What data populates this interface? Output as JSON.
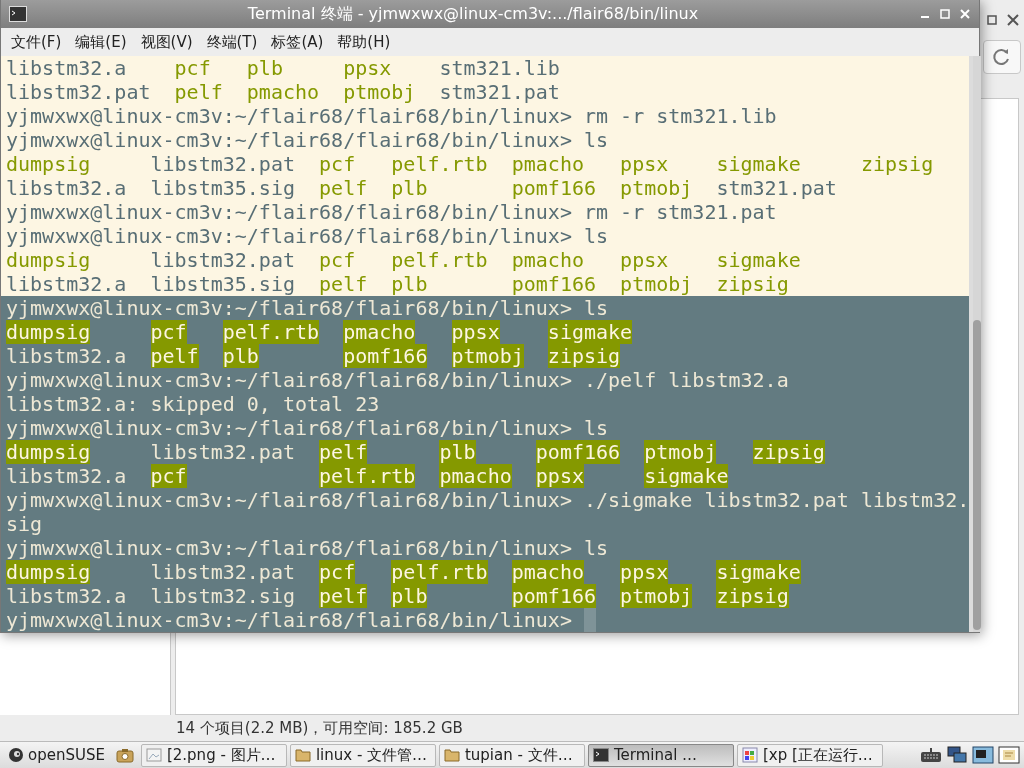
{
  "terminal_window": {
    "title": "Terminal 终端 - yjmwxwx@linux-cm3v:.../flair68/bin/linux",
    "menu": [
      "文件(F)",
      "编辑(E)",
      "视图(V)",
      "终端(T)",
      "标签(A)",
      "帮助(H)"
    ],
    "lines": [
      {
        "kind": "listing",
        "selected": true,
        "rows": [
          [
            {
              "text": "libstm32.a",
              "exec": false
            },
            {
              "text": "pcf",
              "exec": true
            },
            {
              "text": "plb",
              "exec": true
            },
            {
              "text": "ppsx",
              "exec": true
            },
            {
              "text": "stm321.lib",
              "exec": false
            }
          ],
          [
            {
              "text": "libstm32.pat",
              "exec": false
            },
            {
              "text": "pelf",
              "exec": true
            },
            {
              "text": "pmacho",
              "exec": true
            },
            {
              "text": "ptmobj",
              "exec": true
            },
            {
              "text": "stm321.pat",
              "exec": false
            }
          ]
        ]
      },
      {
        "kind": "prompt",
        "selected": true,
        "prompt": "yjmwxwx@linux-cm3v:~/flair68/flair68/bin/linux>",
        "command": "rm -r stm321.lib"
      },
      {
        "kind": "prompt",
        "selected": true,
        "prompt": "yjmwxwx@linux-cm3v:~/flair68/flair68/bin/linux>",
        "command": "ls"
      },
      {
        "kind": "listing",
        "selected": true,
        "rows": [
          [
            {
              "text": "dumpsig",
              "exec": true
            },
            {
              "text": "libstm32.pat",
              "exec": false
            },
            {
              "text": "pcf",
              "exec": true
            },
            {
              "text": "pelf.rtb",
              "exec": true
            },
            {
              "text": "pmacho",
              "exec": true
            },
            {
              "text": "ppsx",
              "exec": true
            },
            {
              "text": "sigmake",
              "exec": true
            },
            {
              "text": "zipsig",
              "exec": true
            }
          ],
          [
            {
              "text": "libstm32.a",
              "exec": false
            },
            {
              "text": "libstm35.sig",
              "exec": false
            },
            {
              "text": "pelf",
              "exec": true
            },
            {
              "text": "plb",
              "exec": true
            },
            {
              "text": "pomf166",
              "exec": true
            },
            {
              "text": "ptmobj",
              "exec": true
            },
            {
              "text": "stm321.pat",
              "exec": false
            }
          ]
        ]
      },
      {
        "kind": "prompt",
        "selected": true,
        "prompt": "yjmwxwx@linux-cm3v:~/flair68/flair68/bin/linux>",
        "command": "rm -r stm321.pat"
      },
      {
        "kind": "prompt",
        "selected": true,
        "prompt": "yjmwxwx@linux-cm3v:~/flair68/flair68/bin/linux>",
        "command": "ls"
      },
      {
        "kind": "listing",
        "selected": true,
        "rows": [
          [
            {
              "text": "dumpsig",
              "exec": true
            },
            {
              "text": "libstm32.pat",
              "exec": false
            },
            {
              "text": "pcf",
              "exec": true
            },
            {
              "text": "pelf.rtb",
              "exec": true
            },
            {
              "text": "pmacho",
              "exec": true
            },
            {
              "text": "ppsx",
              "exec": true
            },
            {
              "text": "sigmake",
              "exec": true
            }
          ],
          [
            {
              "text": "libstm32.a",
              "exec": false
            },
            {
              "text": "libstm35.sig",
              "exec": false
            },
            {
              "text": "pelf",
              "exec": true
            },
            {
              "text": "plb",
              "exec": true
            },
            {
              "text": "pomf166",
              "exec": true
            },
            {
              "text": "ptmobj",
              "exec": true
            },
            {
              "text": "zipsig",
              "exec": true
            }
          ]
        ]
      },
      {
        "kind": "prompt",
        "selected": false,
        "prompt": "yjmwxwx@linux-cm3v:~/flair68/flair68/bin/linux>",
        "command": "ls"
      },
      {
        "kind": "listing",
        "selected": false,
        "rows": [
          [
            {
              "text": "dumpsig",
              "exec": true
            },
            {
              "text": "pcf",
              "exec": true
            },
            {
              "text": "pelf.rtb",
              "exec": true
            },
            {
              "text": "pmacho",
              "exec": true
            },
            {
              "text": "ppsx",
              "exec": true
            },
            {
              "text": "sigmake",
              "exec": true
            }
          ],
          [
            {
              "text": "libstm32.a",
              "exec": false
            },
            {
              "text": "pelf",
              "exec": true
            },
            {
              "text": "plb",
              "exec": true
            },
            {
              "text": "pomf166",
              "exec": true
            },
            {
              "text": "ptmobj",
              "exec": true
            },
            {
              "text": "zipsig",
              "exec": true
            }
          ]
        ]
      },
      {
        "kind": "prompt",
        "selected": false,
        "prompt": "yjmwxwx@linux-cm3v:~/flair68/flair68/bin/linux>",
        "command": "./pelf libstm32.a"
      },
      {
        "kind": "output",
        "selected": false,
        "text": "libstm32.a: skipped 0, total 23"
      },
      {
        "kind": "prompt",
        "selected": false,
        "prompt": "yjmwxwx@linux-cm3v:~/flair68/flair68/bin/linux>",
        "command": "ls"
      },
      {
        "kind": "listing",
        "selected": false,
        "rows": [
          [
            {
              "text": "dumpsig",
              "exec": true
            },
            {
              "text": "libstm32.pat",
              "exec": false
            },
            {
              "text": "pelf",
              "exec": true
            },
            {
              "text": "plb",
              "exec": true
            },
            {
              "text": "pomf166",
              "exec": true
            },
            {
              "text": "ptmobj",
              "exec": true
            },
            {
              "text": "zipsig",
              "exec": true
            }
          ],
          [
            {
              "text": "libstm32.a",
              "exec": false
            },
            {
              "text": "pcf",
              "exec": true
            },
            {
              "text": "pelf.rtb",
              "exec": true
            },
            {
              "text": "pmacho",
              "exec": true
            },
            {
              "text": "ppsx",
              "exec": true
            },
            {
              "text": "sigmake",
              "exec": true
            }
          ]
        ]
      },
      {
        "kind": "prompt",
        "selected": false,
        "prompt": "yjmwxwx@linux-cm3v:~/flair68/flair68/bin/linux>",
        "command": "./sigmake libstm32.pat libstm32.sig"
      },
      {
        "kind": "prompt",
        "selected": false,
        "prompt": "yjmwxwx@linux-cm3v:~/flair68/flair68/bin/linux>",
        "command": "ls"
      },
      {
        "kind": "listing",
        "selected": false,
        "rows": [
          [
            {
              "text": "dumpsig",
              "exec": true
            },
            {
              "text": "libstm32.pat",
              "exec": false
            },
            {
              "text": "pcf",
              "exec": true
            },
            {
              "text": "pelf.rtb",
              "exec": true
            },
            {
              "text": "pmacho",
              "exec": true
            },
            {
              "text": "ppsx",
              "exec": true
            },
            {
              "text": "sigmake",
              "exec": true
            }
          ],
          [
            {
              "text": "libstm32.a",
              "exec": false
            },
            {
              "text": "libstm32.sig",
              "exec": false
            },
            {
              "text": "pelf",
              "exec": true
            },
            {
              "text": "plb",
              "exec": true
            },
            {
              "text": "pomf166",
              "exec": true
            },
            {
              "text": "ptmobj",
              "exec": true
            },
            {
              "text": "zipsig",
              "exec": true
            }
          ]
        ]
      },
      {
        "kind": "prompt",
        "selected": false,
        "prompt": "yjmwxwx@linux-cm3v:~/flair68/flair68/bin/linux>",
        "cursor": true
      }
    ]
  },
  "file_manager": {
    "status": "14 个项目(2.2 MB)，可用空间: 185.2 GB"
  },
  "taskbar": {
    "start": "openSUSE",
    "tasks": [
      {
        "label": "[2.png - 图片…",
        "kind": "image",
        "selected": false
      },
      {
        "label": "linux - 文件管…",
        "kind": "folder",
        "selected": false
      },
      {
        "label": "tupian - 文件…",
        "kind": "folder",
        "selected": false
      },
      {
        "label": "Terminal …",
        "kind": "terminal",
        "selected": true
      },
      {
        "label": "[xp [正在运行…",
        "kind": "vm",
        "selected": false
      }
    ]
  }
}
